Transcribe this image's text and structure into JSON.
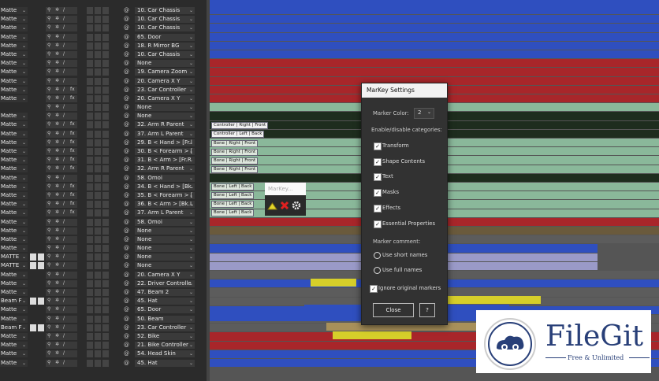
{
  "layers": [
    {
      "mode": "Matte",
      "parent": "10. Car Chassis",
      "fx": false,
      "extra": false
    },
    {
      "mode": "Matte",
      "parent": "10. Car Chassis",
      "fx": false,
      "extra": false
    },
    {
      "mode": "Matte",
      "parent": "10. Car Chassis",
      "fx": false,
      "extra": false
    },
    {
      "mode": "Matte",
      "parent": "65. Door",
      "fx": false,
      "extra": false
    },
    {
      "mode": "Matte",
      "parent": "18. R Mirror BG",
      "fx": false,
      "extra": false
    },
    {
      "mode": "Matte",
      "parent": "10. Car Chassis",
      "fx": false,
      "extra": false
    },
    {
      "mode": "Matte",
      "parent": "None",
      "fx": false,
      "extra": false
    },
    {
      "mode": "Matte",
      "parent": "19. Camera Zoom",
      "fx": false,
      "extra": false
    },
    {
      "mode": "Matte",
      "parent": "20. Camera X Y",
      "fx": false,
      "extra": false
    },
    {
      "mode": "Matte",
      "parent": "23. Car Controller",
      "fx": true,
      "extra": false
    },
    {
      "mode": "Matte",
      "parent": "20. Camera X Y",
      "fx": true,
      "extra": false
    },
    {
      "mode": "",
      "parent": "None",
      "fx": false,
      "extra": false
    },
    {
      "mode": "Matte",
      "parent": "None",
      "fx": false,
      "extra": false
    },
    {
      "mode": "Matte",
      "parent": "32. Arm R Parent",
      "fx": true,
      "extra": false
    },
    {
      "mode": "Matte",
      "parent": "37. Arm L Parent",
      "fx": true,
      "extra": false
    },
    {
      "mode": "Matte",
      "parent": "29. B < Hand > [Fr.l",
      "fx": true,
      "extra": false
    },
    {
      "mode": "Matte",
      "parent": "30. B < Forearm > [",
      "fx": true,
      "extra": false
    },
    {
      "mode": "Matte",
      "parent": "31. B < Arm > [Fr.R",
      "fx": true,
      "extra": false
    },
    {
      "mode": "Matte",
      "parent": "32. Arm R Parent",
      "fx": true,
      "extra": false
    },
    {
      "mode": "Matte",
      "parent": "58. Omoi",
      "fx": false,
      "extra": false
    },
    {
      "mode": "Matte",
      "parent": "34. B < Hand > [Bk.",
      "fx": true,
      "extra": false
    },
    {
      "mode": "Matte",
      "parent": "35. B < Forearm > [",
      "fx": true,
      "extra": false
    },
    {
      "mode": "Matte",
      "parent": "36. B < Arm > [Bk.L",
      "fx": true,
      "extra": false
    },
    {
      "mode": "Matte",
      "parent": "37. Arm L Parent",
      "fx": true,
      "extra": false
    },
    {
      "mode": "Matte",
      "parent": "58. Omoi",
      "fx": false,
      "extra": false
    },
    {
      "mode": "Matte",
      "parent": "None",
      "fx": false,
      "extra": false
    },
    {
      "mode": "Matte",
      "parent": "None",
      "fx": false,
      "extra": false
    },
    {
      "mode": "Matte",
      "parent": "None",
      "fx": false,
      "extra": false
    },
    {
      "mode": "MATTE",
      "parent": "None",
      "fx": false,
      "extra": true
    },
    {
      "mode": "MATTE",
      "parent": "None",
      "fx": false,
      "extra": true
    },
    {
      "mode": "Matte",
      "parent": "20. Camera X Y",
      "fx": false,
      "extra": false
    },
    {
      "mode": "Matte",
      "parent": "22. Driver Controlle",
      "fx": false,
      "extra": false
    },
    {
      "mode": "Matte",
      "parent": "47. Beam 2",
      "fx": false,
      "extra": false
    },
    {
      "mode": "Beam F",
      "parent": "45. Hat",
      "fx": false,
      "extra": true
    },
    {
      "mode": "Matte",
      "parent": "65. Door",
      "fx": false,
      "extra": false
    },
    {
      "mode": "Matte",
      "parent": "50. Beam",
      "fx": false,
      "extra": false
    },
    {
      "mode": "Beam F",
      "parent": "23. Car Controller",
      "fx": false,
      "extra": true
    },
    {
      "mode": "Matte",
      "parent": "52. Bike",
      "fx": false,
      "extra": false
    },
    {
      "mode": "Matte",
      "parent": "21. Bike Controller",
      "fx": false,
      "extra": false
    },
    {
      "mode": "Matte",
      "parent": "54. Head Skin",
      "fx": false,
      "extra": false
    },
    {
      "mode": "Matte",
      "parent": "45. Hat",
      "fx": false,
      "extra": false
    }
  ],
  "track_colors": {
    "blue": "#2f4fbf",
    "red": "#a8262a",
    "dark_green": "#1e2d1e",
    "light_green": "#8ab89a",
    "brown": "#6a5a3c",
    "lavender": "#9a9ac8",
    "yellow": "#d6cf2a",
    "tan": "#a8905a",
    "gray": "#5c5c5c"
  },
  "markers": [
    "Controller | Right | Front",
    "Controller | Left | Back",
    "Bone | Right | Front",
    "Bone | Right | Front",
    "Bone | Right | Front",
    "Bone | Right | Front",
    "Bone | Left | Back",
    "Bone | Left | Back",
    "Bone | Left | Back",
    "Bone | Left | Back"
  ],
  "markey_popup": {
    "title": "MarKey..."
  },
  "dialog": {
    "title": "MarKey Settings",
    "marker_color_label": "Marker Color:",
    "marker_color_value": "2",
    "categories_label": "Enable/disable categories:",
    "categories": [
      {
        "label": "Transform",
        "checked": true
      },
      {
        "label": "Shape Contents",
        "checked": true
      },
      {
        "label": "Text",
        "checked": true
      },
      {
        "label": "Masks",
        "checked": true
      },
      {
        "label": "Effects",
        "checked": true
      },
      {
        "label": "Essential Properties",
        "checked": true
      }
    ],
    "comment_label": "Marker comment:",
    "radio_short": "Use short names",
    "radio_full": "Use full names",
    "ignore_label": "Ignore original markers",
    "ignore_checked": true,
    "close_label": "Close",
    "help_label": "?"
  },
  "watermark": {
    "brand": "FileGit",
    "tagline": "Free & Unlimited"
  }
}
